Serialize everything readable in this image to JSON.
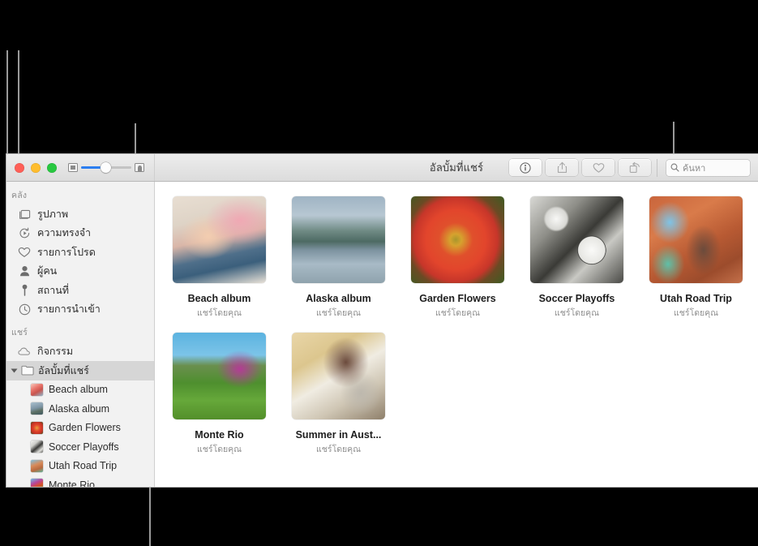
{
  "window": {
    "title": "อัลบั้มที่แชร์",
    "traffic_lights": [
      "close",
      "minimize",
      "zoom"
    ]
  },
  "toolbar": {
    "zoom_slider": {
      "min_icon": "small-thumbnail-icon",
      "max_icon": "large-thumbnail-icon",
      "value_percent": 50
    },
    "buttons": [
      {
        "name": "info-button",
        "icon": "info-icon",
        "enabled": true
      },
      {
        "name": "share-button",
        "icon": "share-icon",
        "enabled": false
      },
      {
        "name": "favorite-button",
        "icon": "heart-icon",
        "enabled": false
      },
      {
        "name": "rotate-button",
        "icon": "rotate-icon",
        "enabled": false
      }
    ],
    "search": {
      "placeholder": "ค้นหา",
      "value": "",
      "icon": "search-icon"
    }
  },
  "sidebar": {
    "sections": [
      {
        "title": "คลัง",
        "items": [
          {
            "label": "รูปภาพ",
            "icon": "photos-icon"
          },
          {
            "label": "ความทรงจำ",
            "icon": "memories-icon"
          },
          {
            "label": "รายการโปรด",
            "icon": "heart-icon"
          },
          {
            "label": "ผู้คน",
            "icon": "people-icon"
          },
          {
            "label": "สถานที่",
            "icon": "places-pin-icon"
          },
          {
            "label": "รายการนำเข้า",
            "icon": "imports-clock-icon"
          }
        ]
      },
      {
        "title": "แชร์",
        "items": [
          {
            "label": "กิจกรรม",
            "icon": "cloud-activity-icon"
          }
        ]
      }
    ],
    "shared_albums_header": {
      "label": "อัลบั้มที่แชร์",
      "icon": "folder-icon",
      "disclosure": "expanded",
      "selected": true
    },
    "albums": [
      {
        "label": "Beach album"
      },
      {
        "label": "Alaska album"
      },
      {
        "label": "Garden Flowers"
      },
      {
        "label": "Soccer Playoffs"
      },
      {
        "label": "Utah Road Trip"
      },
      {
        "label": "Monte Rio"
      }
    ]
  },
  "content": {
    "albums": [
      {
        "name": "Beach album",
        "subtitle": "แชร์โดยคุณ"
      },
      {
        "name": "Alaska album",
        "subtitle": "แชร์โดยคุณ"
      },
      {
        "name": "Garden Flowers",
        "subtitle": "แชร์โดยคุณ"
      },
      {
        "name": "Soccer Playoffs",
        "subtitle": "แชร์โดยคุณ"
      },
      {
        "name": "Utah Road Trip",
        "subtitle": "แชร์โดยคุณ"
      },
      {
        "name": "Monte Rio",
        "subtitle": "แชร์โดยคุณ"
      },
      {
        "name": "Summer in Aust...",
        "subtitle": "แชร์โดยคุณ"
      }
    ]
  },
  "colors": {
    "accent": "#2b7ef0",
    "callout_line": "#9a9a9a",
    "selection": "#d6d6d6",
    "background": "#000000",
    "window_bg": "#ffffff",
    "sidebar_bg": "#f2f2f2"
  }
}
